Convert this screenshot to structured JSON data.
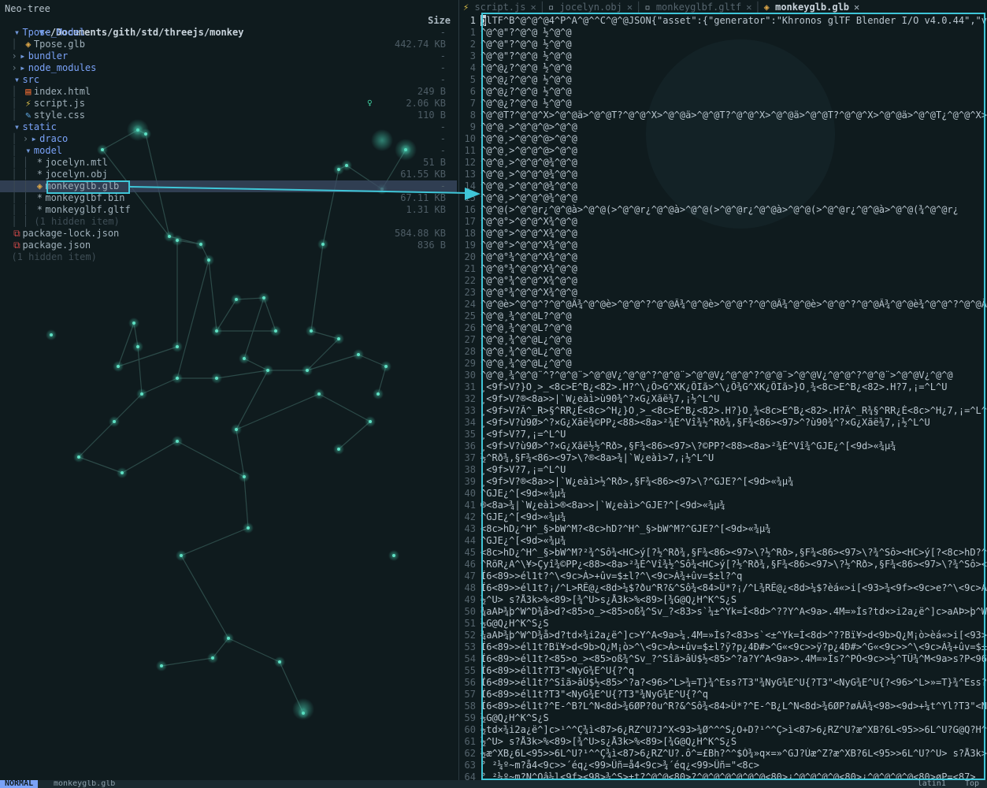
{
  "colors": {
    "background": "#0f1b1e",
    "accent": "#3fc6d8",
    "directory": "#7aa2f7"
  },
  "tree": {
    "title": "Neo-tree",
    "header_path": "~/Documents/gith/std/threejs/monkey",
    "size_label": "Size",
    "items": [
      {
        "name": "Tpose_Model",
        "type": "dir-open",
        "depth": 0,
        "icon": "folder-open-icon",
        "size": "-"
      },
      {
        "name": "Tpose.glb",
        "type": "file",
        "depth": 1,
        "icon": "package-icon",
        "size": "442.74 KB"
      },
      {
        "name": "bundler",
        "type": "dir-closed",
        "depth": 0,
        "icon": "folder-icon",
        "size": "-"
      },
      {
        "name": "node_modules",
        "type": "dir-closed",
        "depth": 0,
        "icon": "folder-icon",
        "size": "-"
      },
      {
        "name": "src",
        "type": "dir-open",
        "depth": 0,
        "icon": "folder-open-icon",
        "size": "-"
      },
      {
        "name": "index.html",
        "type": "file",
        "depth": 1,
        "icon": "html-icon",
        "size": "249 B"
      },
      {
        "name": "script.js",
        "type": "file",
        "depth": 1,
        "icon": "js-icon",
        "size": "2.06 KB"
      },
      {
        "name": "style.css",
        "type": "file",
        "depth": 1,
        "icon": "css-icon",
        "size": "110 B"
      },
      {
        "name": "static",
        "type": "dir-open",
        "depth": 0,
        "icon": "folder-open-icon",
        "size": "-"
      },
      {
        "name": "draco",
        "type": "dir-closed",
        "depth": 1,
        "icon": "folder-icon",
        "size": "-"
      },
      {
        "name": "model",
        "type": "dir-open",
        "depth": 1,
        "icon": "folder-open-icon",
        "size": "-"
      },
      {
        "name": "jocelyn.mtl",
        "type": "file",
        "depth": 2,
        "icon": "star-icon",
        "size": "51 B"
      },
      {
        "name": "jocelyn.obj",
        "type": "file",
        "depth": 2,
        "icon": "star-icon",
        "size": "61.55 KB"
      },
      {
        "name": "monkeyglb.glb",
        "type": "file",
        "depth": 2,
        "icon": "package-icon",
        "size": "-",
        "selected": true
      },
      {
        "name": "monkeyglbf.bin",
        "type": "file",
        "depth": 2,
        "icon": "star-icon",
        "size": "67.11 KB"
      },
      {
        "name": "monkeyglbf.gltf",
        "type": "file",
        "depth": 2,
        "icon": "star-icon",
        "size": "1.31 KB"
      },
      {
        "name": "(1 hidden item)",
        "type": "hidden",
        "depth": 2,
        "icon": "",
        "size": ""
      },
      {
        "name": "package-lock.json",
        "type": "file",
        "depth": 0,
        "icon": "json-icon",
        "size": "584.88 KB"
      },
      {
        "name": "package.json",
        "type": "file",
        "depth": 0,
        "icon": "json-icon",
        "size": "836 B"
      },
      {
        "name": "(1 hidden item)",
        "type": "hidden",
        "depth": 0,
        "icon": "",
        "size": ""
      }
    ]
  },
  "tabs": [
    {
      "label": "script.js",
      "icon": "js-icon",
      "active": false
    },
    {
      "label": "jocelyn.obj",
      "icon": "file-icon",
      "active": false
    },
    {
      "label": "monkeyglbf.gltf",
      "icon": "file-icon",
      "active": false
    },
    {
      "label": "monkeyglb.glb",
      "icon": "package-icon",
      "active": true
    }
  ],
  "editor": {
    "lines": [
      {
        "n": "1",
        "t": "glTF^B^@^@^@4^P^A^@^^C^@^@JSON{\"asset\":{\"generator\":\"Khronos glTF Blender I/O v4.0.44\",\"ver"
      },
      {
        "n": "1",
        "t": "^@^@\"?^@^@ ½^@^@"
      },
      {
        "n": "2",
        "t": "^@^@\"?^@^@ ½^@^@"
      },
      {
        "n": "3",
        "t": "^@^@\"?^@^@ ½^@^@"
      },
      {
        "n": "4",
        "t": "^@^@¿?^@^@ ½^@^@"
      },
      {
        "n": "5",
        "t": "^@^@¿?^@^@ ½^@^@"
      },
      {
        "n": "6",
        "t": "^@^@¿?^@^@ ½^@^@"
      },
      {
        "n": "7",
        "t": "^@^@¿?^@^@ ½^@^@"
      },
      {
        "n": "8",
        "t": "^@^@T?^@^@^X>^@^@ä>^@^@T?^@^@^X>^@^@ä>^@^@T?^@^@^X>^@^@ä>^@^@T?^@^@^X>^@^@ä>^@^@T¿^@^@^X>^"
      },
      {
        "n": "9",
        "t": "^@^@¸>^@^@^@>^@^@"
      },
      {
        "n": "10",
        "t": "^@^@¸>^@^@^@>^@^@"
      },
      {
        "n": "11",
        "t": "^@^@¸>^@^@^@>^@^@"
      },
      {
        "n": "12",
        "t": "^@^@¸>^@^@^@¾^@^@"
      },
      {
        "n": "13",
        "t": "^@^@¸>^@^@^@¾^@^@"
      },
      {
        "n": "14",
        "t": "^@^@¸>^@^@^@¾^@^@"
      },
      {
        "n": "15",
        "t": "^@^@¸>^@^@^@¾^@^@"
      },
      {
        "n": "16",
        "t": "^@^@(>^@^@r¿^@^@à>^@^@(>^@^@r¿^@^@à>^@^@(>^@^@r¿^@^@à>^@^@(>^@^@r¿^@^@à>^@^@(¾^@^@r¿"
      },
      {
        "n": "17",
        "t": "^@^@°>^@^@^X¾^@^@"
      },
      {
        "n": "18",
        "t": "^@^@°>^@^@^X¾^@^@"
      },
      {
        "n": "19",
        "t": "^@^@°>^@^@^X¾^@^@"
      },
      {
        "n": "20",
        "t": "^@^@°¾^@^@^X¾^@^@"
      },
      {
        "n": "21",
        "t": "^@^@°¾^@^@^X¾^@^@"
      },
      {
        "n": "22",
        "t": "^@^@°¾^@^@^X¾^@^@"
      },
      {
        "n": "23",
        "t": "^@^@°¾^@^@^X¾^@^@"
      },
      {
        "n": "24",
        "t": "^@^@è>^@^@^?^@^@Â¾^@^@è>^@^@^?^@^@Â¾^@^@è>^@^@^?^@^@Â¾^@^@è>^@^@^?^@^@Â¾^@^@è¾^@^@^?^@^@Â¾"
      },
      {
        "n": "25",
        "t": "^@^@¸¾^@^@L?^@^@"
      },
      {
        "n": "26",
        "t": "^@^@¸¾^@^@L?^@^@"
      },
      {
        "n": "27",
        "t": "^@^@¸¾^@^@L¿^@^@"
      },
      {
        "n": "28",
        "t": "^@^@¸¾^@^@L¿^@^@"
      },
      {
        "n": "29",
        "t": "^@^@¸¾^@^@L¿^@^@"
      },
      {
        "n": "30",
        "t": "^@^@¸¾^@^@¨^?^@^@¨>^@^@V¿^@^@^?^@^@¨>^@^@V¿^@^@^?^@^@¨>^@^@V¿^@^@^?^@^@¨>^@^@V¿^@^@"
      },
      {
        "n": "31",
        "t": "¸<9f>V?}O¸>_<8c>E^B¿<82>.H?^\\¿Õ>G^XK¿ÕIã>^\\¿Õ¾G^XK¿ÕIã>}O¸¾<8c>E^B¿<82>.H?7,¡=^L^U"
      },
      {
        "n": "32",
        "t": "¸<9f>V?®<8a>>|`W¿eàì>ù90¾^?×G¿Xãë¾7,¡½^L^U"
      },
      {
        "n": "33",
        "t": "¸<9f>V?Ã^_R>§^RR¿É<8c>^H¿}O¸>_<8c>E^B¿<82>.H?}O¸¾<8c>E^B¿<82>.H?Ã^_R¾§^RR¿È<8c>^H¿7,¡=^L^U"
      },
      {
        "n": "34",
        "t": "¸<9f>V?ù9Ø>^?×G¿Xãë¾©PP¿<88><8a>²¾É^Vî¾½^Rð¾,§F¾<86><97>^?ù90¾^?×G¿Xãë¾7,¡½^L^U"
      },
      {
        "n": "35",
        "t": "¸<9f>V?7,¡=^L^U"
      },
      {
        "n": "36",
        "t": "¸<9f>V?ù9Ø>^?×G¿Xãë½½^Rð>,§F¾<86><97>\\?©PP?<88><8a>²¾É^Vî¾^GJE¿^[<9d>«¾µ¾"
      },
      {
        "n": "37",
        "t": "½^Rð¾,§F¾<86><97>\\?®<8a>¾|`W¿eàì>7,¡½^L^U"
      },
      {
        "n": "38",
        "t": "¸<9f>V?7,¡=^L^U"
      },
      {
        "n": "39",
        "t": "¸<9f>V?®<8a>>|`W¿eàì>½^Rð>,§F¾<86><97>\\?^GJE?^[<9d>«¾µ¾"
      },
      {
        "n": "40",
        "t": "^GJE¿^[<9d>«¾µ¾"
      },
      {
        "n": "41",
        "t": "®<8a>¾|`W¿eàì>®<8a>>|`W¿eàì>^GJE?^[<9d>«¾µ¾"
      },
      {
        "n": "42",
        "t": "^GJE¿^[<9d>«¾µ¾"
      },
      {
        "n": "43",
        "t": "<8c>hD¿^H^_§>bW^M?<8c>hD?^H^_§>bW^M?^GJE?^[<9d>«¾µ¾"
      },
      {
        "n": "44",
        "t": "^GJE¿^[<9d>«¾µ¾"
      },
      {
        "n": "45",
        "t": "<8c>hD¿^H^_§>bW^M?²¾^Sô¾<HC>ý[?½^Rð¾,§F¾<86><97>\\?½^Rð>,§F¾<86><97>\\?¾^Sô><HC>ý[?<8c>hD?^H^"
      },
      {
        "n": "46",
        "t": "^RõR¿A^\\¥>Çyî¾©PP¿<88><8a>²¾É^Vî¾½^Sô¾<HC>ý[?½^Rð¾,§F¾<86><97>\\?½^Rð>,§F¾<86><97>\\?¾^Sô><H"
      },
      {
        "n": "47",
        "t": "Ï6<89>>él1t?^\\<9c>À>+ûv=$±l?^\\<9c>À¾+ûv=$±l?^q"
      },
      {
        "n": "48",
        "t": "Ï6<89>>él1t?¡/^L>RÊ@¿<8d>¼$?ðu^R?&^Sô¾<84>Û*?¡/^L¾RÊ@¿<8d>¼$?èá«>i[<93>¾<9f><9c>e?^\\<9c>À>+"
      },
      {
        "n": "49",
        "t": "½^U> s?Å3k>%<89>[¾^U>s¿Å3k>%<89>[¾G@Q¿H^K^S¿S"
      },
      {
        "n": "50",
        "t": "¾aAÞ¾þ^W^D¾å>d?<85>o_><85>oß¾^Sv_?<83>s`¼±^Yk=Ì<8d>^??Y^A<9a>.4M=»Ìs?td×>i2a¿ë^]c>aAÞ>þ^W"
      },
      {
        "n": "51",
        "t": "½G@Q¿H^K^S¿S"
      },
      {
        "n": "52",
        "t": "¾aAÞ¾þ^W^D¾å>d?td×¾i2a¿ë^]c>Y^A<9a>¼.4M=»Ìs?<83>s`<±^Yk=Ì<8d>^??Bï¥>d<9b>Q¿M¡ò>èá«>i[<93>"
      },
      {
        "n": "53",
        "t": "Ï6<89>>él1t?Bï¥>d<9b>Q¿M¡ò>^\\<9c>À>+ûv=$±l?ÿ?p¿4Ð#>^G«<9c>>ÿ?p¿4Ð#>^G«<9c>>^\\<9c>À¾+ûv=$±l?"
      },
      {
        "n": "54",
        "t": "Ï6<89>>él1t?<85>o_><85>oß¾^Sv_?^Sîã>âÚ$½<85>^?a?Y^A<9a>>.4M=»Ìs?^PÒ<9c>>½^TÜ¾^M<9a>s?P<96>G"
      },
      {
        "n": "55",
        "t": "Ï6<89>>él1t?T3\"<NyG¾E^U{?^q"
      },
      {
        "n": "56",
        "t": "Ï6<89>>él1t?^Sîã>âÚ$½<85>^?a?<96>^L>¾=T}¾^Ess?T3\"¾NyG¾E^U{?T3\"<NyG¾E^U{?<96>^L>»=T}¾^Ess?<"
      },
      {
        "n": "57",
        "t": "Ï6<89>>él1t?T3\"<NyG¾E^U{?T3\"¾NyG¾E^U{?^q"
      },
      {
        "n": "58",
        "t": "Ï6<89>>él1t?^E-^B?L^N<8d>¾6ØP?0u^R?&^Sô¾<84>Û*?^E-^B¿L^N<8d>¾6ØP?øÀÂ¾<98><9d>+¼t^Yl?T3\"<NyG"
      },
      {
        "n": "59",
        "t": "½G@Q¿H^K^S¿S"
      },
      {
        "n": "60",
        "t": "½td×¾i2a¿ë^]c>¹^^Ç¾ì<87>6¿RZ^U?J^X<93>¾Ø^^^S¿O+D?¹^^Ç>ì<87>6¿RZ^U?æ^XB?6L<95>>6L^U?G@Q?H^"
      },
      {
        "n": "61",
        "t": "½^U> s?Å3k>%<89>[¾^U>s¿Å3k>%<89>[¾G@Q¿H^K^S¿S"
      },
      {
        "n": "62",
        "t": "½æ^XB¿6L<95>>6L^U?¹^^Ç¾ì<87>6¿RZ^U?.ô^=£Bh?^^$Ó¾»q×=»^GJ?Ùæ^Z?æ^XB?6L<95>>6L^U?^U> s?Å3k>"
      },
      {
        "n": "63",
        "t": "° ²¼º~m?å4<9c>>´éq¿<99>Üñ=å4<9c>¾´éq¿<99>Üñ=\"<8c>"
      },
      {
        "n": "64",
        "t": "° ²¼º~m?N^Oâ¼l<9f><98>¾^S>±t?^@^@<80>?^@^@^@^@^@^@<80>¿^@^@^@^@<80>¿^@^@^@^@<80>øP=<87>"
      }
    ]
  },
  "status": {
    "mode": "NORMAL",
    "file": "monkeyglb.glb",
    "encoding": "latin1",
    "position": "Top"
  }
}
